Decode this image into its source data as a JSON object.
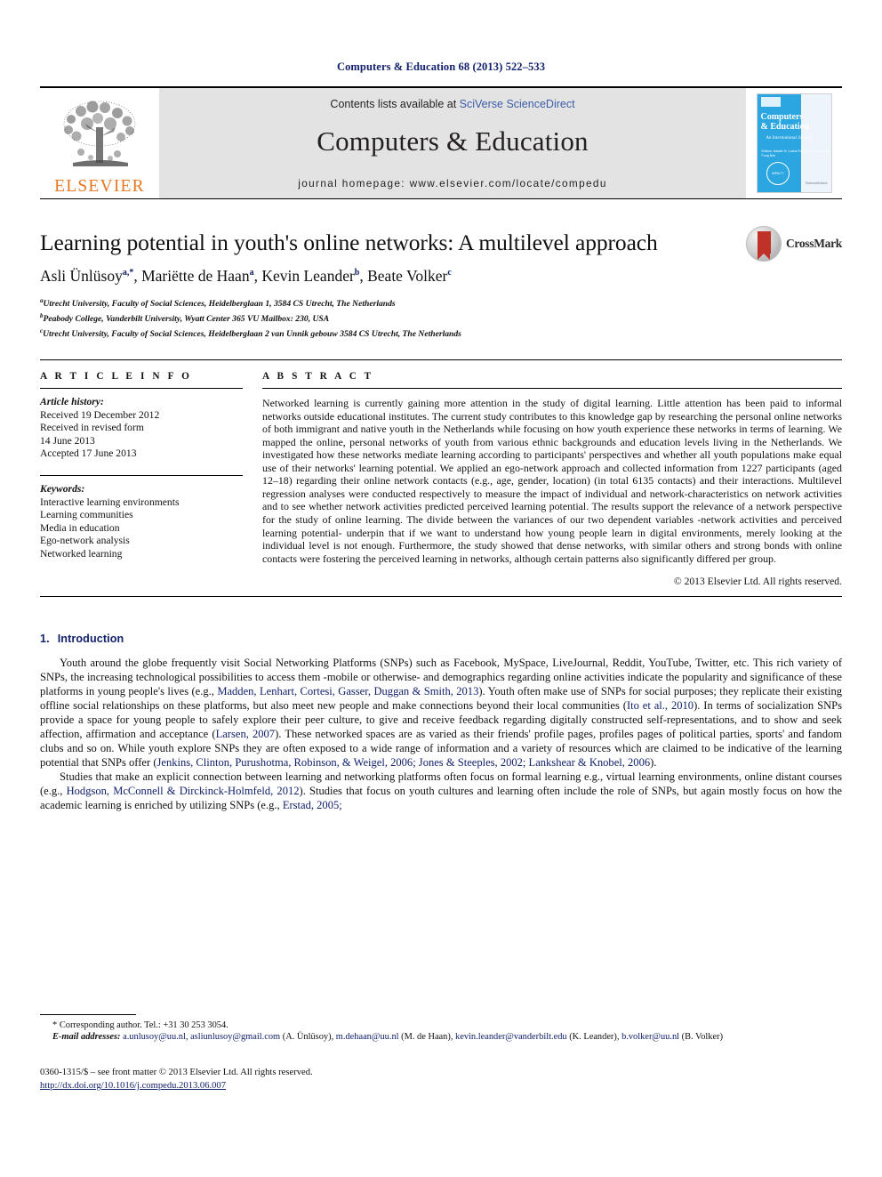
{
  "running_head": "Computers & Education 68 (2013) 522–533",
  "masthead": {
    "publisher_logo_label": "ELSEVIER",
    "contents_prefix": "Contents lists available at ",
    "contents_link": "SciVerse ScienceDirect",
    "journal_title": "Computers & Education",
    "homepage": "journal homepage: www.elsevier.com/locate/compedu",
    "cover": {
      "title_line1": "Computers",
      "title_line2": "& Education",
      "subtitle": "An International Journal",
      "editors": "Editors:\nNatalie N. Lucha\nRon C.H. Cheung\nWan Fung Bok",
      "seal": "IMPACT\nFACTOR\n2.630",
      "publisher": "ScienceDirect"
    }
  },
  "article": {
    "title": "Learning potential in youth's online networks: A multilevel approach",
    "authors": [
      {
        "name": "Asli Ünlüsoy",
        "marks": "a,*"
      },
      {
        "name": "Mariëtte de Haan",
        "marks": "a"
      },
      {
        "name": "Kevin Leander",
        "marks": "b"
      },
      {
        "name": "Beate Volker",
        "marks": "c"
      }
    ],
    "affiliations": [
      {
        "mark": "a",
        "text": "Utrecht University, Faculty of Social Sciences, Heidelberglaan 1, 3584 CS Utrecht, The Netherlands"
      },
      {
        "mark": "b",
        "text": "Peabody College, Vanderbilt University, Wyatt Center 365 VU Mailbox: 230, USA"
      },
      {
        "mark": "c",
        "text": "Utrecht University, Faculty of Social Sciences, Heidelberglaan 2 van Unnik gebouw 3584 CS Utrecht, The Netherlands"
      }
    ],
    "crossmark_label": "CrossMark"
  },
  "article_info": {
    "heading": "A R T I C L E   I N F O",
    "history_label": "Article history:",
    "history": [
      "Received 19 December 2012",
      "Received in revised form",
      "14 June 2013",
      "Accepted 17 June 2013"
    ],
    "keywords_label": "Keywords:",
    "keywords": [
      "Interactive learning environments",
      "Learning communities",
      "Media in education",
      "Ego-network analysis",
      "Networked learning"
    ]
  },
  "abstract": {
    "heading": "A B S T R A C T",
    "text": "Networked learning is currently gaining more attention in the study of digital learning. Little attention has been paid to informal networks outside educational institutes. The current study contributes to this knowledge gap by researching the personal online networks of both immigrant and native youth in the Netherlands while focusing on how youth experience these networks in terms of learning. We mapped the online, personal networks of youth from various ethnic backgrounds and education levels living in the Netherlands. We investigated how these networks mediate learning according to participants' perspectives and whether all youth populations make equal use of their networks' learning potential. We applied an ego-network approach and collected information from 1227 participants (aged 12–18) regarding their online network contacts (e.g., age, gender, location) (in total 6135 contacts) and their interactions. Multilevel regression analyses were conducted respectively to measure the impact of individual and network-characteristics on network activities and to see whether network activities predicted perceived learning potential. The results support the relevance of a network perspective for the study of online learning. The divide between the variances of our two dependent variables -network activities and perceived learning potential- underpin that if we want to understand how young people learn in digital environments, merely looking at the individual level is not enough. Furthermore, the study showed that dense networks, with similar others and strong bonds with online contacts were fostering the perceived learning in networks, although certain patterns also significantly differed per group.",
    "copyright": "© 2013 Elsevier Ltd. All rights reserved."
  },
  "introduction": {
    "number": "1.",
    "title": "Introduction",
    "paragraph1_a": "Youth around the globe frequently visit Social Networking Platforms (SNPs) such as Facebook, MySpace, LiveJournal, Reddit, YouTube, Twitter, etc. This rich variety of SNPs, the increasing technological possibilities to access them -mobile or otherwise- and demographics regarding online activities indicate the popularity and significance of these platforms in young people's lives (e.g., ",
    "paragraph1_ref1": "Madden, Lenhart, Cortesi, Gasser, Duggan & Smith, 2013",
    "paragraph1_b": "). Youth often make use of SNPs for social purposes; they replicate their existing offline social relationships on these platforms, but also meet new people and make connections beyond their local communities (",
    "paragraph1_ref2": "Ito et al., 2010",
    "paragraph1_c": "). In terms of socialization SNPs provide a space for young people to safely explore their peer culture, to give and receive feedback regarding digitally constructed self-representations, and to show and seek affection, affirmation and acceptance (",
    "paragraph1_ref3": "Larsen, 2007",
    "paragraph1_d": "). These networked spaces are as varied as their friends' profile pages, profiles pages of political parties, sports' and fandom clubs and so on. While youth explore SNPs they are often exposed to a wide range of information and a variety of resources which are claimed to be indicative of the learning potential that SNPs offer (",
    "paragraph1_ref4": "Jenkins, Clinton, Purushotma, Robinson, & Weigel, 2006; Jones & Steeples, 2002; Lankshear & Knobel, 2006",
    "paragraph1_e": ").",
    "paragraph2_a": "Studies that make an explicit connection between learning and networking platforms often focus on formal learning e.g., virtual learning environments, online distant courses (e.g., ",
    "paragraph2_ref1": "Hodgson, McConnell & Dirckinck-Holmfeld, 2012",
    "paragraph2_b": "). Studies that focus on youth cultures and learning often include the role of SNPs, but again mostly focus on how the academic learning is enriched by utilizing SNPs (e.g., ",
    "paragraph2_ref2": "Erstad, 2005;",
    "paragraph2_c": ""
  },
  "footnotes": {
    "corresponding_marker": "*",
    "corresponding": "Corresponding author. Tel.: +31 30 253 3054.",
    "email_label": "E-mail addresses:",
    "emails": [
      {
        "address": "a.unlusoy@uu.nl",
        "owner": ""
      },
      {
        "address": "asliunlusoy@gmail.com",
        "owner": "(A. Ünlüsoy)"
      },
      {
        "address": "m.dehaan@uu.nl",
        "owner": "(M. de Haan)"
      },
      {
        "address": "kevin.leander@vanderbilt.edu",
        "owner": "(K. Leander)"
      },
      {
        "address": "b.volker@uu.nl",
        "owner": "(B. Volker)"
      }
    ],
    "imprint": "0360-1315/$ – see front matter © 2013 Elsevier Ltd. All rights reserved.",
    "doi": "http://dx.doi.org/10.1016/j.compedu.2013.06.007"
  }
}
